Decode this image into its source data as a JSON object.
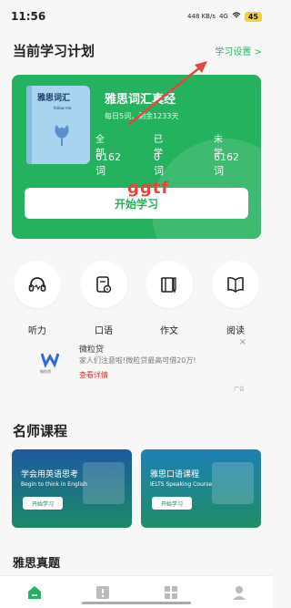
{
  "status": {
    "time": "11:56",
    "network": "4G",
    "speed": "448 KB/s",
    "battery": "45"
  },
  "header": {
    "title": "当前学习计划",
    "settings": "学习设置"
  },
  "plan": {
    "book_cover_title": "雅思词汇",
    "book_cover_sub": "follow me",
    "book_name": "雅思词汇真经",
    "progress_text": "每日5词，剩余1233天",
    "stats": [
      {
        "label": "全部",
        "value": "6162词"
      },
      {
        "label": "已学",
        "value": "0词"
      },
      {
        "label": "未学",
        "value": "6162词"
      }
    ],
    "start_button": "开始学习",
    "watermark": "ggtf"
  },
  "features": [
    {
      "label": "听力",
      "icon": "headphones-icon"
    },
    {
      "label": "口语",
      "icon": "speaking-icon"
    },
    {
      "label": "作文",
      "icon": "writing-icon"
    },
    {
      "label": "阅读",
      "icon": "reading-icon"
    }
  ],
  "ad": {
    "logo_caption": "微粒贷",
    "title": "微粒贷",
    "desc": "家人们注意啦!微粒贷最高可借20万!",
    "link": "查看详情",
    "tag": "广告",
    "close": "×"
  },
  "courses_section": {
    "title": "名师课程"
  },
  "courses": [
    {
      "title": "学会用英语思考",
      "sub": "Begin to think in English",
      "btn": "开始学习"
    },
    {
      "title": "雅思口语课程",
      "sub": "IELTS Speaking Course",
      "btn": "开始学习"
    }
  ],
  "exam_section": {
    "title": "雅思真题"
  },
  "colors": {
    "primary": "#24b25e",
    "annotation": "#e2483d"
  }
}
